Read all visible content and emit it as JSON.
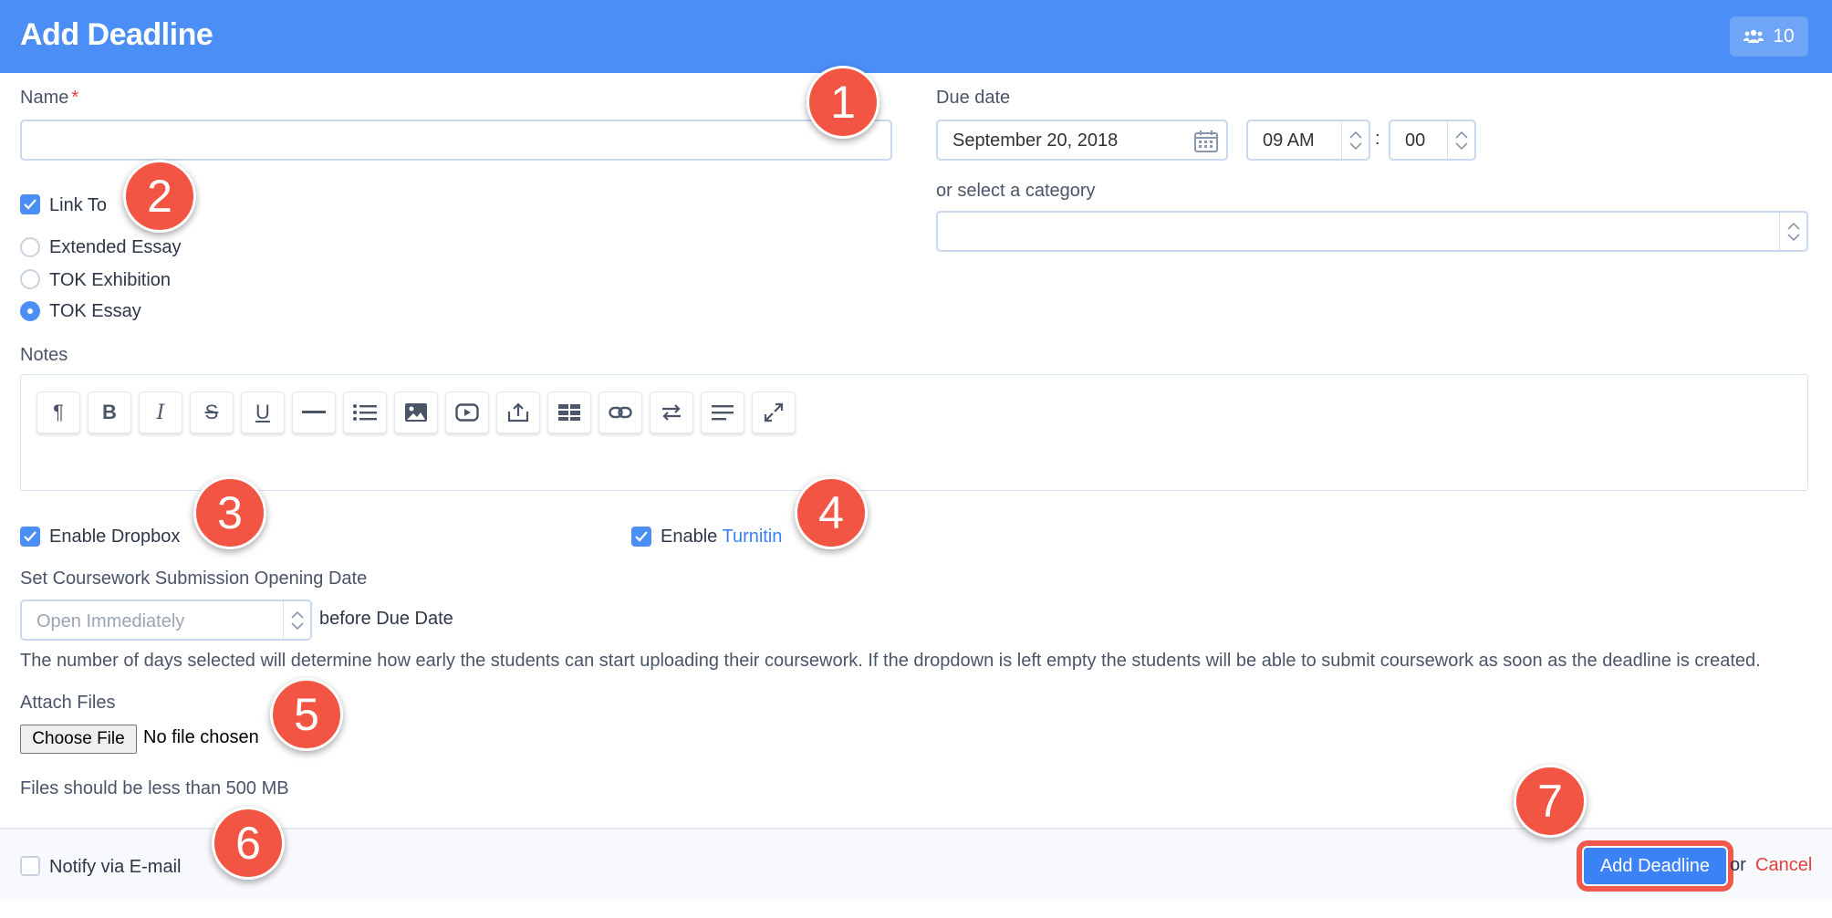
{
  "header": {
    "title": "Add Deadline",
    "members_count": "10"
  },
  "form": {
    "name_label": "Name",
    "name_required_mark": "*",
    "name_value": "",
    "due_date_label": "Due date",
    "due_date_value": "September 20, 2018",
    "hour_value": "09 AM",
    "time_separator": ":",
    "minute_value": "00",
    "category_label": "or select a category",
    "category_value": "",
    "link_to_label": "Link To",
    "link_to_checked": true,
    "link_options": [
      {
        "label": "Extended Essay",
        "selected": false
      },
      {
        "label": "TOK Exhibition",
        "selected": false
      },
      {
        "label": "TOK Essay",
        "selected": true
      }
    ],
    "notes_label": "Notes",
    "toolbar_icons": [
      "paragraph-icon",
      "bold-icon",
      "italic-icon",
      "strikethrough-icon",
      "underline-icon",
      "horizontal-rule-icon",
      "list-icon",
      "image-icon",
      "video-icon",
      "upload-icon",
      "table-icon",
      "link-icon",
      "swap-icon",
      "align-icon",
      "fullscreen-icon"
    ],
    "enable_dropbox_label": "Enable Dropbox",
    "enable_turnitin_prefix": "Enable",
    "turnitin_link": "Turnitin",
    "opening_date_label": "Set Coursework Submission Opening Date",
    "opening_placeholder": "Open Immediately",
    "before_due_label": "before Due Date",
    "help_text": "The number of days selected will determine how early the students can start uploading their coursework. If the dropdown is left empty the students will be able to submit coursework as soon as the deadline is created.",
    "attach_label": "Attach Files",
    "choose_file_label": "Choose File",
    "no_file_label": "No file chosen",
    "file_limit_text": "Files should be less than 500 MB"
  },
  "footer": {
    "notify_label": "Notify via E-mail",
    "notify_checked": false,
    "add_button": "Add Deadline",
    "or_text": "or",
    "cancel_link": "Cancel"
  },
  "annotations": [
    "1",
    "2",
    "3",
    "4",
    "5",
    "6",
    "7"
  ],
  "colors": {
    "header": "#4b8ef5",
    "primary": "#3b82f6",
    "badge": "#f25544",
    "cancel": "#e53e3e"
  }
}
